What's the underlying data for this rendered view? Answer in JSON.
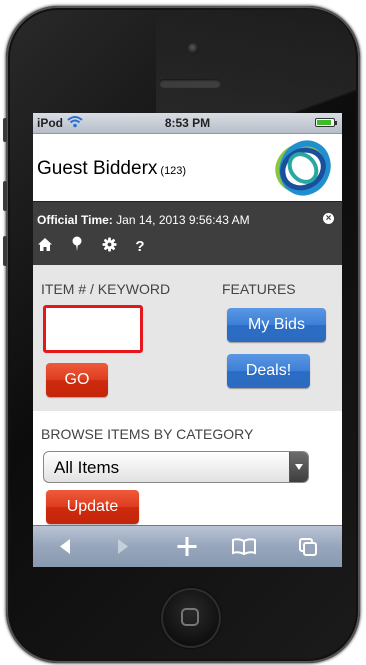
{
  "status_bar": {
    "carrier": "iPod",
    "time": "8:53 PM",
    "battery_level": 0.9
  },
  "header": {
    "user_name": "Guest Bidderx",
    "account_number": "(123)"
  },
  "info_bar": {
    "official_time_label": "Official Time:",
    "official_time_value": "Jan 14, 2013 9:56:43 AM",
    "close_glyph": "×",
    "nav_icons": [
      "home-icon",
      "pin-icon",
      "gear-icon",
      "help-icon"
    ],
    "help_glyph": "?"
  },
  "search": {
    "keyword_label": "ITEM # / KEYWORD",
    "keyword_value": "",
    "go_label": "GO"
  },
  "features": {
    "label": "FEATURES",
    "my_bids_label": "My Bids",
    "deals_label": "Deals!"
  },
  "browse": {
    "label": "BROWSE ITEMS BY CATEGORY",
    "selected_category": "All Items",
    "update_label": "Update"
  },
  "browser_toolbar": {
    "icons": [
      "back-icon",
      "forward-icon",
      "add-icon",
      "bookmarks-icon",
      "pages-icon"
    ]
  },
  "colors": {
    "accent_red": "#dd3c1f",
    "accent_blue": "#3c7fd6",
    "info_bar_bg": "#3e3e3e",
    "panel_bg": "#e6e6e6",
    "keyword_border": "#e5161c"
  }
}
